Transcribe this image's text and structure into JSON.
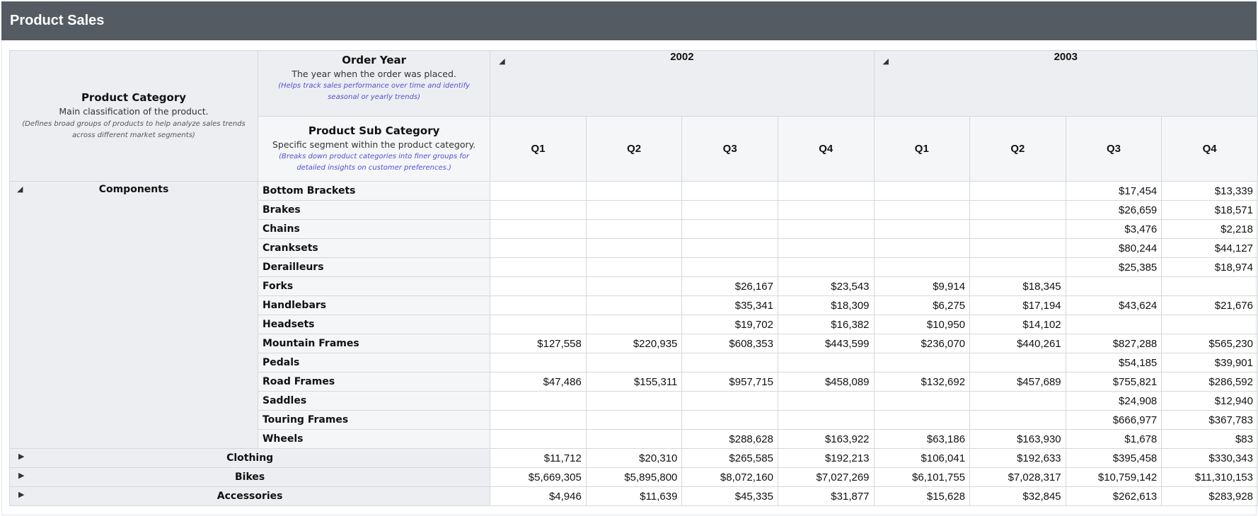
{
  "title": "Product Sales",
  "header": {
    "row_dim": {
      "title": "Product Category",
      "desc": "Main classification of the product.",
      "help": "(Defines broad groups of products to help analyze sales trends across different market segments)"
    },
    "col_dim": {
      "title": "Order Year",
      "desc": "The year when the order was placed.",
      "help": "(Helps track sales performance over time and identify seasonal or yearly trends)"
    },
    "sub_dim": {
      "title": "Product Sub Category",
      "desc": "Specific segment within the product category.",
      "help": "(Breaks down product categories into finer groups for detailed insights on customer preferences.)"
    },
    "years": [
      "2002",
      "2003"
    ],
    "quarters": [
      "Q1",
      "Q2",
      "Q3",
      "Q4",
      "Q1",
      "Q2",
      "Q3",
      "Q4"
    ]
  },
  "icons": {
    "expanded": "expanded-triangle-icon",
    "collapsed": "collapsed-triangle-icon"
  },
  "expanded_category": {
    "label": "Components",
    "rows": [
      {
        "label": "Bottom Brackets",
        "values": [
          "",
          "",
          "",
          "",
          "",
          "",
          "$17,454",
          "$13,339"
        ]
      },
      {
        "label": "Brakes",
        "values": [
          "",
          "",
          "",
          "",
          "",
          "",
          "$26,659",
          "$18,571"
        ]
      },
      {
        "label": "Chains",
        "values": [
          "",
          "",
          "",
          "",
          "",
          "",
          "$3,476",
          "$2,218"
        ]
      },
      {
        "label": "Cranksets",
        "values": [
          "",
          "",
          "",
          "",
          "",
          "",
          "$80,244",
          "$44,127"
        ]
      },
      {
        "label": "Derailleurs",
        "values": [
          "",
          "",
          "",
          "",
          "",
          "",
          "$25,385",
          "$18,974"
        ]
      },
      {
        "label": "Forks",
        "values": [
          "",
          "",
          "$26,167",
          "$23,543",
          "$9,914",
          "$18,345",
          "",
          ""
        ]
      },
      {
        "label": "Handlebars",
        "values": [
          "",
          "",
          "$35,341",
          "$18,309",
          "$6,275",
          "$17,194",
          "$43,624",
          "$21,676"
        ]
      },
      {
        "label": "Headsets",
        "values": [
          "",
          "",
          "$19,702",
          "$16,382",
          "$10,950",
          "$14,102",
          "",
          ""
        ]
      },
      {
        "label": "Mountain Frames",
        "values": [
          "$127,558",
          "$220,935",
          "$608,353",
          "$443,599",
          "$236,070",
          "$440,261",
          "$827,288",
          "$565,230"
        ]
      },
      {
        "label": "Pedals",
        "values": [
          "",
          "",
          "",
          "",
          "",
          "",
          "$54,185",
          "$39,901"
        ]
      },
      {
        "label": "Road Frames",
        "values": [
          "$47,486",
          "$155,311",
          "$957,715",
          "$458,089",
          "$132,692",
          "$457,689",
          "$755,821",
          "$286,592"
        ]
      },
      {
        "label": "Saddles",
        "values": [
          "",
          "",
          "",
          "",
          "",
          "",
          "$24,908",
          "$12,940"
        ]
      },
      {
        "label": "Touring Frames",
        "values": [
          "",
          "",
          "",
          "",
          "",
          "",
          "$666,977",
          "$367,783"
        ]
      },
      {
        "label": "Wheels",
        "values": [
          "",
          "",
          "$288,628",
          "$163,922",
          "$63,186",
          "$163,930",
          "$1,678",
          "$83"
        ]
      }
    ]
  },
  "collapsed_categories": [
    {
      "label": "Clothing",
      "values": [
        "$11,712",
        "$20,310",
        "$265,585",
        "$192,213",
        "$106,041",
        "$192,633",
        "$395,458",
        "$330,343"
      ]
    },
    {
      "label": "Bikes",
      "values": [
        "$5,669,305",
        "$5,895,800",
        "$8,072,160",
        "$7,027,269",
        "$6,101,755",
        "$7,028,317",
        "$10,759,142",
        "$11,310,153"
      ]
    },
    {
      "label": "Accessories",
      "values": [
        "$4,946",
        "$11,639",
        "$45,335",
        "$31,877",
        "$15,628",
        "$32,845",
        "$262,613",
        "$283,928"
      ]
    }
  ]
}
